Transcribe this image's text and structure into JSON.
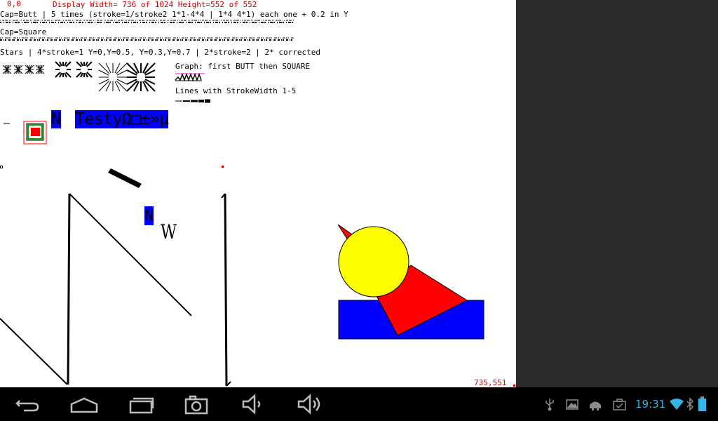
{
  "canvas": {
    "origin_label": "0,0",
    "display_info": "Display Width= 736 of 1024 Height=552 of 552",
    "cap_butt_line": "Cap=Butt | 5 times (stroke=1/stroke2 1*1-4*4 | 1*4 4*1) each one + 0.2 in Y",
    "cap_square_line": "Cap=Square",
    "stars_line": "Stars | 4*stroke=1 Y=0,Y=0.5, Y=0.3,Y=0.7 | 2*stroke=2 | 2* corrected",
    "graph_label": "Graph: first BUTT then SQUARE",
    "lines_label": "Lines with StrokeWidth 1-5",
    "char_n": "N",
    "test_string": "TestyΩ□±»µ",
    "small_n": "N",
    "w_glyph": "W",
    "corner_coords": "735,551"
  },
  "colors": {
    "blue": "#0000ff",
    "red": "#ff0000",
    "yellow": "#ffff00",
    "green": "#00a000",
    "label_red": "#cc0000",
    "clock_blue": "#33b5e5"
  },
  "statusbar": {
    "time": "19:31",
    "icons": [
      "usb-icon",
      "gallery-icon",
      "android-debug-icon",
      "briefcase-icon",
      "wifi-icon",
      "bluetooth-icon",
      "battery-icon"
    ]
  },
  "navbar": {
    "buttons": [
      "back-button",
      "home-button",
      "recent-apps-button",
      "screenshot-button",
      "volume-down-button",
      "volume-up-button"
    ]
  }
}
